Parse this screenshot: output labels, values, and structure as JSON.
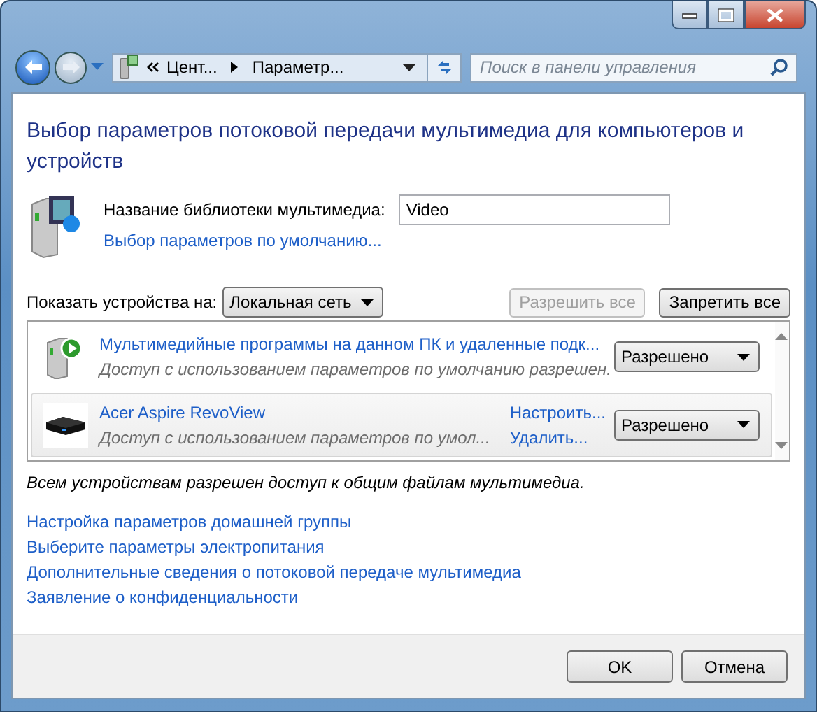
{
  "address_bar": {
    "breadcrumbs": [
      "Цент...",
      "Параметр..."
    ]
  },
  "search": {
    "placeholder": "Поиск в панели управления"
  },
  "heading": "Выбор параметров потоковой передачи мультимедиа для компьютеров и устройств",
  "library": {
    "label": "Название библиотеки мультимедиа:",
    "value": "Video",
    "link": "Выбор параметров по умолчанию..."
  },
  "show_devices": {
    "label": "Показать устройства на:",
    "value": "Локальная сеть"
  },
  "buttons": [
    {
      "label": "Разрешить все",
      "disabled": true
    },
    {
      "label": "Запретить все",
      "disabled": false
    }
  ],
  "devices": [
    {
      "kind": "media-server",
      "name": "Мультимедийные программы на данном ПК и удаленные подк...",
      "description": "Доступ с использованием параметров по умолчанию разрешен.",
      "access": "Разрешено",
      "selected": false
    },
    {
      "kind": "player",
      "name": "Acer Aspire RevoView",
      "description": "Доступ с использованием параметров по умол...",
      "actions": [
        "Настроить...",
        "Удалить..."
      ],
      "access": "Разрешено",
      "selected": true
    }
  ],
  "status": "Всем устройствам разрешен доступ к общим файлам мультимедиа.",
  "links": [
    "Настройка параметров домашней группы",
    "Выберите параметры электропитания",
    "Дополнительные сведения о потоковой передаче мультимедиа",
    "Заявление о конфиденциальности"
  ],
  "footer_buttons": [
    "OK",
    "Отмена"
  ]
}
